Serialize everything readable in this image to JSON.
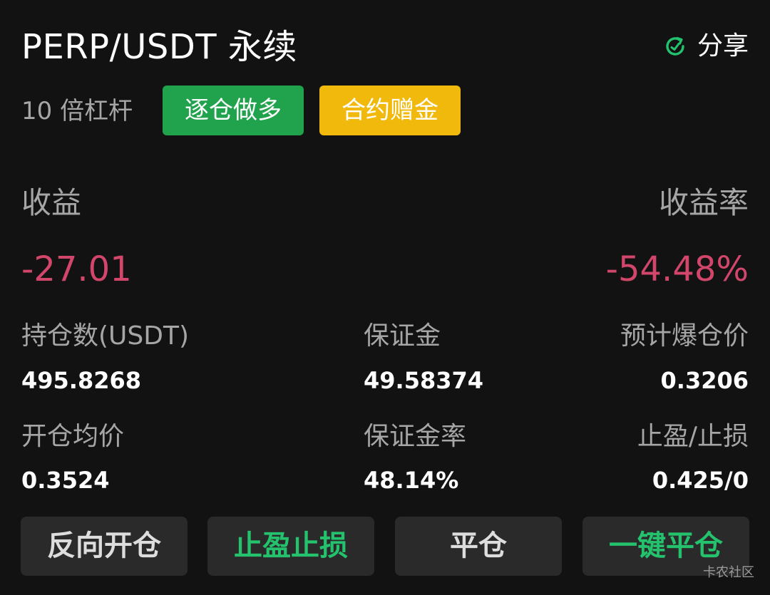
{
  "header": {
    "title": "PERP/USDT 永续",
    "share_label": "分享",
    "share_icon": "share-icon",
    "share_icon_color": "#22c26e"
  },
  "tags": {
    "leverage": "10 倍杠杆",
    "margin_mode": "逐仓做多",
    "bonus": "合约赠金",
    "margin_mode_color": "#21a34e",
    "bonus_color": "#f0b90b"
  },
  "pnl": {
    "profit_label": "收益",
    "profit_value": "-27.01",
    "rate_label": "收益率",
    "rate_value": "-54.48%",
    "negative_color": "#d1466a"
  },
  "stats": {
    "position_size_label": "持仓数(USDT)",
    "position_size_value": "495.8268",
    "margin_label": "保证金",
    "margin_value": "49.58374",
    "liq_price_label": "预计爆仓价",
    "liq_price_value": "0.3206",
    "entry_price_label": "开仓均价",
    "entry_price_value": "0.3524",
    "margin_ratio_label": "保证金率",
    "margin_ratio_value": "48.14%",
    "tp_sl_label": "止盈/止损",
    "tp_sl_value": "0.425/0"
  },
  "actions": {
    "reverse_label": "反向开仓",
    "tp_sl_label": "止盈止损",
    "close_label": "平仓",
    "close_all_label": "一键平仓",
    "accent_color": "#25c26e"
  },
  "watermark": "卡农社区"
}
